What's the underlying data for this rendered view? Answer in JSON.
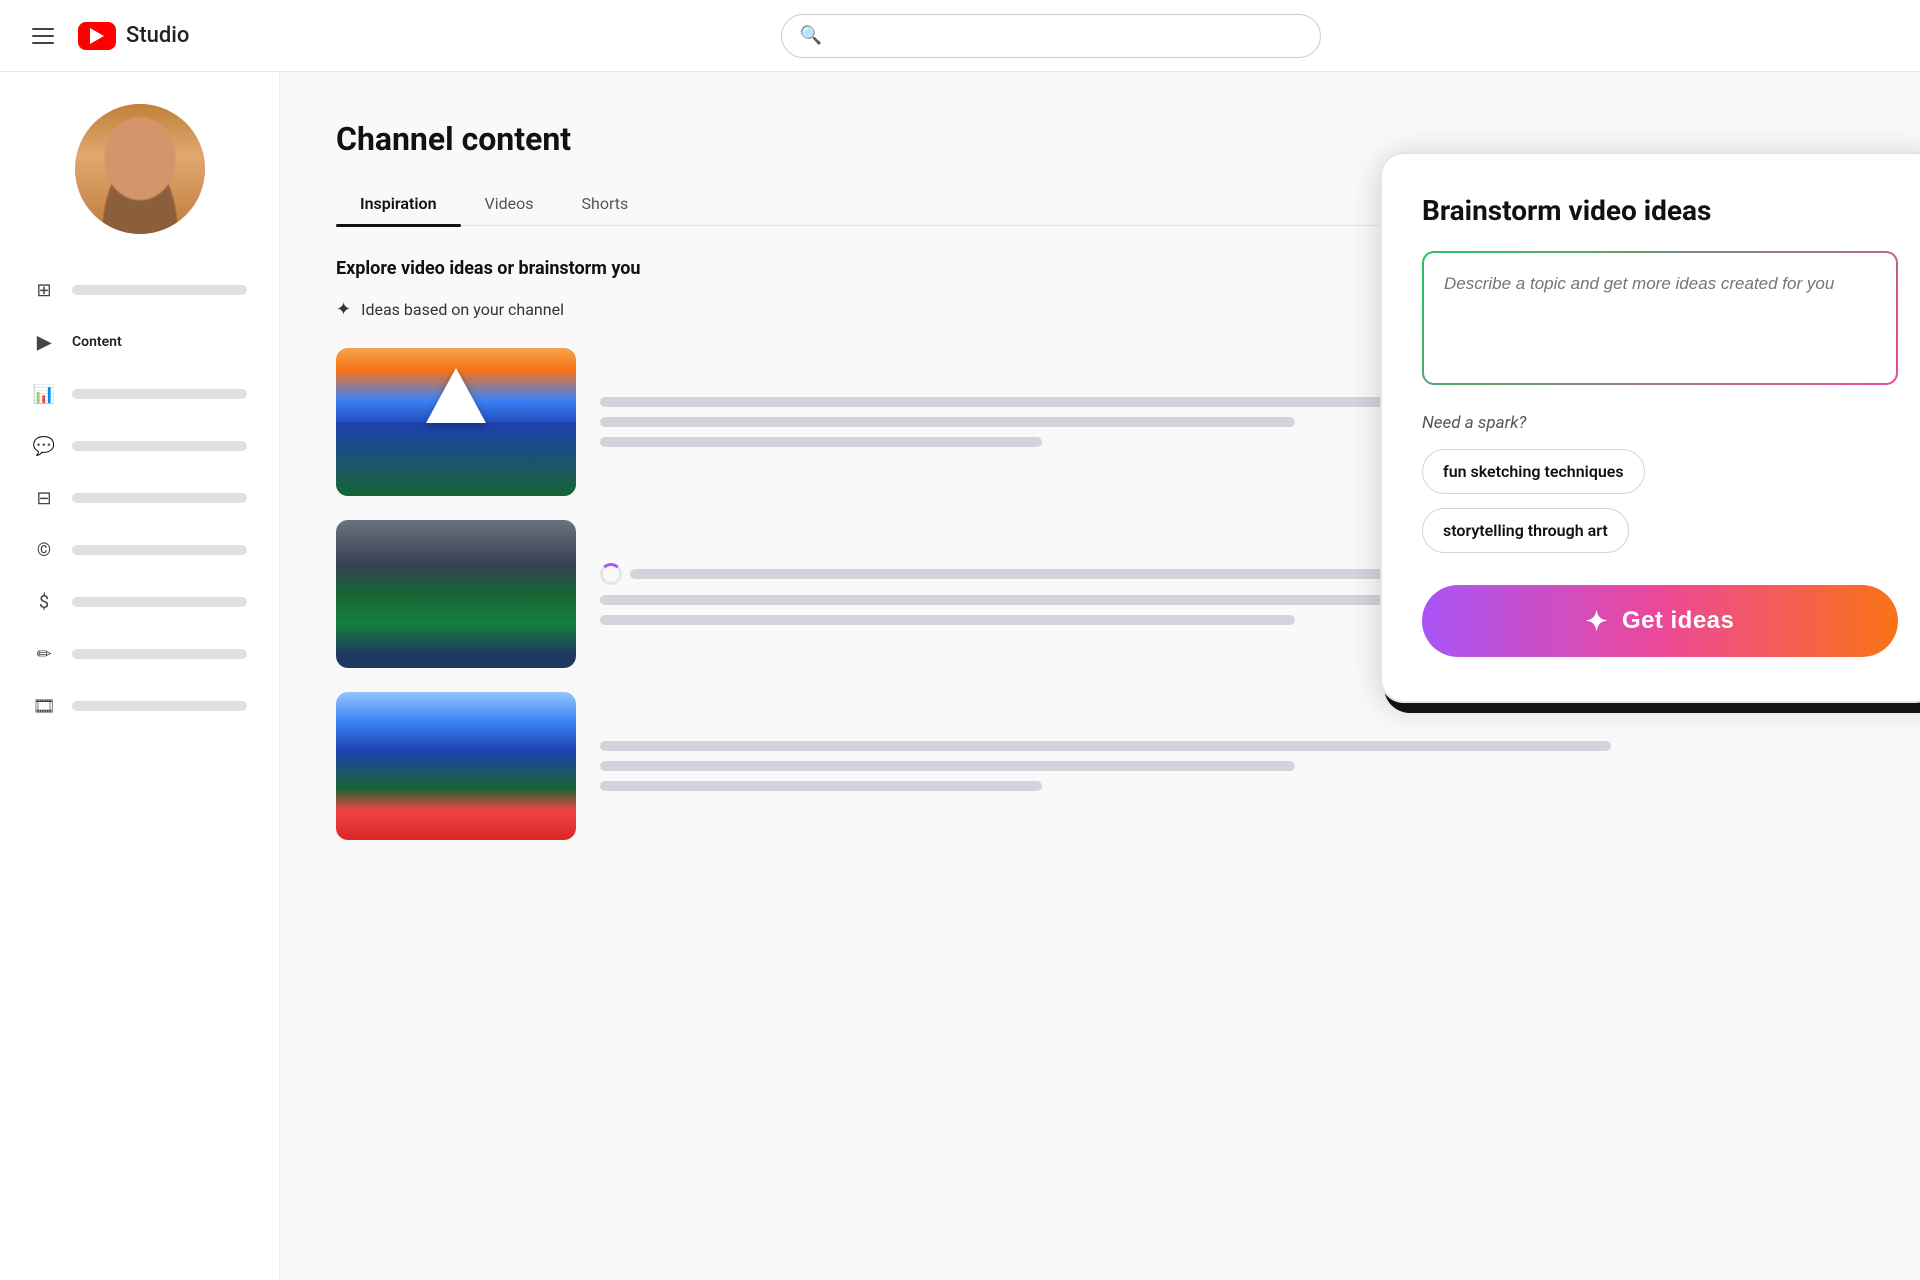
{
  "topbar": {
    "hamburger_label": "Menu",
    "logo_text": "Studio",
    "search_placeholder": ""
  },
  "sidebar": {
    "avatar_alt": "User avatar",
    "nav_items": [
      {
        "id": "dashboard",
        "icon": "⊞",
        "label": "",
        "active": false
      },
      {
        "id": "content",
        "icon": "▶",
        "label": "Content",
        "active": true
      },
      {
        "id": "analytics",
        "icon": "📊",
        "label": "",
        "active": false
      },
      {
        "id": "comments",
        "icon": "💬",
        "label": "",
        "active": false
      },
      {
        "id": "subtitles",
        "icon": "⊟",
        "label": "",
        "active": false
      },
      {
        "id": "copyright",
        "icon": "©",
        "label": "",
        "active": false
      },
      {
        "id": "monetization",
        "icon": "$",
        "label": "",
        "active": false
      },
      {
        "id": "customization",
        "icon": "✏",
        "label": "",
        "active": false
      },
      {
        "id": "other",
        "icon": "🎞",
        "label": "",
        "active": false
      }
    ]
  },
  "main": {
    "page_title": "Channel content",
    "tabs": [
      {
        "id": "inspiration",
        "label": "Inspiration",
        "active": true
      },
      {
        "id": "videos",
        "label": "Videos",
        "active": false
      },
      {
        "id": "shorts",
        "label": "Shorts",
        "active": false
      }
    ],
    "explore_subtitle": "Explore video ideas or brainstorm you",
    "channel_ideas_label": "Ideas based on your channel",
    "videos": [
      {
        "id": 1,
        "thumb_class": "thumb-1",
        "has_spinner": false
      },
      {
        "id": 2,
        "thumb_class": "thumb-2",
        "has_spinner": true
      },
      {
        "id": 3,
        "thumb_class": "thumb-3",
        "has_spinner": false
      }
    ]
  },
  "brainstorm_panel": {
    "title": "Brainstorm video ideas",
    "textarea_placeholder": "Describe a topic and get more ideas created for you",
    "spark_label": "Need a spark?",
    "chips": [
      {
        "id": "chip1",
        "label": "fun sketching techniques"
      },
      {
        "id": "chip2",
        "label": "storytelling through art"
      }
    ],
    "get_ideas_label": "Get ideas",
    "sparkle": "✦"
  }
}
